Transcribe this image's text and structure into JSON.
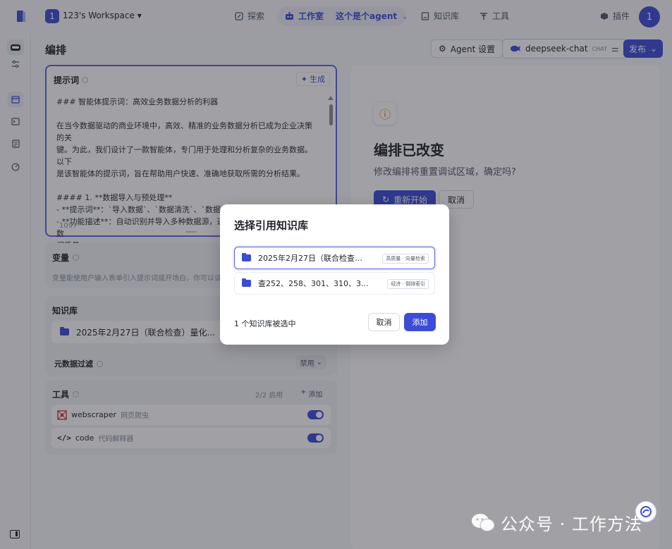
{
  "topbar": {
    "workspace_badge": "1",
    "workspace_name": "123's Workspace",
    "nav": {
      "explore": "探索",
      "studio": "工作室",
      "agent_name": "这个是个agent",
      "knowledge": "知识库",
      "tools": "工具",
      "plugins": "插件"
    },
    "avatar": "1"
  },
  "page": {
    "title": "编排",
    "agent_settings_label": "Agent 设置",
    "model_name": "deepseek-chat",
    "model_tag": "CHAT",
    "publish_label": "发布"
  },
  "prompt": {
    "label": "提示词",
    "generate_label": "生成",
    "lines": [
      "### 智能体提示词：高效业务数据分析的利器",
      "",
      "在当今数据驱动的商业环境中，高效、精准的业务数据分析已成为企业决策的关",
      "键。为此，我们设计了一款智能体，专门用于处理和分析复杂的业务数据。以下",
      "是该智能体的提示词，旨在帮助用户快速、准确地获取所需的分析结果。",
      "",
      "#### 1. **数据导入与预处理**",
      "- **提示词**：`导入数据`、`数据清洗`、`数据格式化`",
      "- **功能描述**：自动识别并导入多种数据源，进行数据清洗和格式化，确保数",
      "据质量。"
    ],
    "char_count": "1097"
  },
  "variables": {
    "title": "变量",
    "desc": "变量能使用户输入表单引入提示词或开场白，你可以试试"
  },
  "knowledge": {
    "title": "知识库",
    "item": "2025年2月27日（联合检查）量化...",
    "metadata_filter": "元数据过滤",
    "filter_value": "禁用"
  },
  "tools": {
    "title": "工具",
    "count": "2/2 启用",
    "add_label": "添加",
    "items": [
      {
        "name": "webscraper",
        "desc": "网页爬虫"
      },
      {
        "name": "code",
        "desc": "代码解释器"
      }
    ]
  },
  "right_panel": {
    "title": "编排已改变",
    "text": "修改编排将重置调试区域，确定吗?",
    "restart_label": "重新开始",
    "cancel_label": "取消"
  },
  "modal": {
    "title": "选择引用知识库",
    "options": [
      {
        "name": "2025年2月27日（联合检查）量化...",
        "tag": "高质量 · 向量检索",
        "selected": true
      },
      {
        "name": "查252、258、301、310、3...",
        "tag": "经济 · 倒排索引",
        "selected": false
      }
    ],
    "selected_count": "1 个知识库被选中",
    "cancel_label": "取消",
    "add_label": "添加"
  },
  "watermark": {
    "text": "公众号 · 工作方法"
  },
  "colors": {
    "accent": "#3d4cd6",
    "warning": "#e07b00"
  }
}
